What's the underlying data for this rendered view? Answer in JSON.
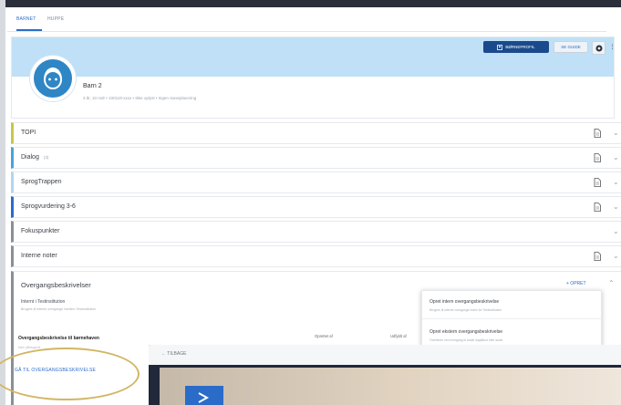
{
  "tabs": [
    {
      "label": "BARNET"
    },
    {
      "label": "HUPPE"
    }
  ],
  "header": {
    "primary_button": "BØRNEPROFIL",
    "secondary_button": "SE GUIDE",
    "child_name": "Barn 2",
    "child_meta": "3 år, 10 mdr • 100119-xxxx • Ikke oplyst • Ingen stuseplacering"
  },
  "sections": [
    {
      "label": "TOPI",
      "color": "#c8c64a"
    },
    {
      "label": "Dialog",
      "badge": "(3)",
      "color": "#4aa3d8"
    },
    {
      "label": "SprogTrappen",
      "color": "#b3d6ee"
    },
    {
      "label": "Sprogvurdering 3-6",
      "color": "#2a6cc8"
    },
    {
      "label": "Fokuspunkter",
      "color": "#8a8f96"
    },
    {
      "label": "Interne noter",
      "color": "#8a8f96"
    }
  ],
  "overgang": {
    "title": "Overgangsbeskrivelser",
    "sub_title": "Internt i Testinstitution",
    "sub_text": "Brugers til interne overgange imellem Testinstitution",
    "opret": "+ OPRET",
    "row_title": "Overgangsbeskrivelse til børnehaven",
    "row_sub": "Ikke påbegyndt",
    "col_opret": "Oprettet af",
    "col_udfyldt": "Udfyldt af",
    "link": "GÅ TIL OVERGANGSBESKRIVELSE"
  },
  "dropdown": {
    "items": [
      {
        "title": "Opret intern overgangsbeskrivelse",
        "sub": "Brugers til interne overgange inden for Testinstitution"
      },
      {
        "title": "Opret ekstern overgangsbeskrivelse",
        "sub": "Overføres ved overgang til andet dagtilbud eller skole"
      }
    ]
  },
  "video": {
    "back_label": "← TILBAGE"
  },
  "colors": {
    "accent": "#2a6cc8",
    "primary_button": "#1b4a8c",
    "header_band": "#bfe0f6",
    "highlight": "#d2b662"
  }
}
